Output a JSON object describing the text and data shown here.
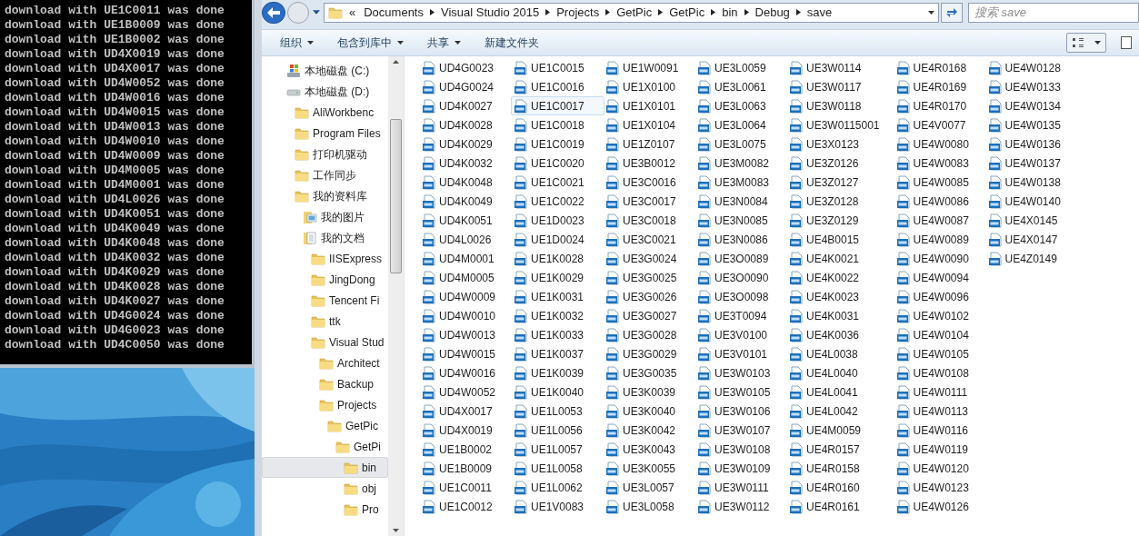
{
  "console": {
    "lines": [
      "download with UE1C0011 was done",
      "download with UE1B0009 was done",
      "download with UE1B0002 was done",
      "download with UD4X0019 was done",
      "download with UD4X0017 was done",
      "download with UD4W0052 was done",
      "download with UD4W0016 was done",
      "download with UD4W0015 was done",
      "download with UD4W0013 was done",
      "download with UD4W0010 was done",
      "download with UD4W0009 was done",
      "download with UD4M0005 was done",
      "download with UD4M0001 was done",
      "download with UD4L0026 was done",
      "download with UD4K0051 was done",
      "download with UD4K0049 was done",
      "download with UD4K0048 was done",
      "download with UD4K0032 was done",
      "download with UD4K0029 was done",
      "download with UD4K0028 was done",
      "download with UD4K0027 was done",
      "download with UD4G0024 was done",
      "download with UD4G0023 was done",
      "download with UD4C0050 was done"
    ]
  },
  "explorer": {
    "address": {
      "overflow": "«",
      "path": [
        "Documents",
        "Visual Studio 2015",
        "Projects",
        "GetPic",
        "GetPic",
        "bin",
        "Debug",
        "save"
      ]
    },
    "search": {
      "placeholder": "搜索 save"
    },
    "toolbar": [
      {
        "label": "组织",
        "dropdown": true
      },
      {
        "label": "包含到库中",
        "dropdown": true
      },
      {
        "label": "共享",
        "dropdown": true
      },
      {
        "label": "新建文件夹",
        "dropdown": false
      }
    ],
    "navigation": [
      {
        "label": "本地磁盘 (C:)",
        "kind": "system-drive",
        "selected": false
      },
      {
        "label": "本地磁盘 (D:)",
        "kind": "drive",
        "selected": false,
        "children": [
          {
            "label": "AliWorkbenc",
            "kind": "folder",
            "selected": false
          },
          {
            "label": "Program Files",
            "kind": "folder",
            "selected": false
          },
          {
            "label": "打印机驱动",
            "kind": "folder",
            "selected": false
          },
          {
            "label": "工作同步",
            "kind": "folder",
            "selected": false
          },
          {
            "label": "我的资料库",
            "kind": "folder",
            "selected": false,
            "children": [
              {
                "label": "我的图片",
                "kind": "pictures",
                "selected": false
              },
              {
                "label": "我的文档",
                "kind": "documents",
                "selected": false,
                "children": [
                  {
                    "label": "IISExpress",
                    "kind": "folder",
                    "selected": false
                  },
                  {
                    "label": "JingDong",
                    "kind": "folder",
                    "selected": false
                  },
                  {
                    "label": "Tencent Fi",
                    "kind": "folder",
                    "selected": false
                  },
                  {
                    "label": "ttk",
                    "kind": "folder",
                    "selected": false
                  },
                  {
                    "label": "Visual Stud",
                    "kind": "folder",
                    "selected": false,
                    "children": [
                      {
                        "label": "Architect",
                        "kind": "folder",
                        "selected": false
                      },
                      {
                        "label": "Backup",
                        "kind": "folder",
                        "selected": false
                      },
                      {
                        "label": "Projects",
                        "kind": "folder",
                        "selected": false,
                        "children": [
                          {
                            "label": "GetPic",
                            "kind": "folder",
                            "selected": false,
                            "children": [
                              {
                                "label": "GetPi",
                                "kind": "folder",
                                "selected": false,
                                "children": [
                                  {
                                    "label": "bin",
                                    "kind": "folder",
                                    "selected": true
                                  },
                                  {
                                    "label": "obj",
                                    "kind": "folder",
                                    "selected": false
                                  },
                                  {
                                    "label": "Pro",
                                    "kind": "folder",
                                    "selected": false
                                  }
                                ]
                              }
                            ]
                          }
                        ]
                      }
                    ]
                  }
                ]
              }
            ]
          }
        ]
      }
    ],
    "files": [
      {
        "name": "UD4G0023",
        "selected": false
      },
      {
        "name": "UD4G0024",
        "selected": false
      },
      {
        "name": "UD4K0027",
        "selected": false
      },
      {
        "name": "UD4K0028",
        "selected": false
      },
      {
        "name": "UD4K0029",
        "selected": false
      },
      {
        "name": "UD4K0032",
        "selected": false
      },
      {
        "name": "UD4K0048",
        "selected": false
      },
      {
        "name": "UD4K0049",
        "selected": false
      },
      {
        "name": "UD4K0051",
        "selected": false
      },
      {
        "name": "UD4L0026",
        "selected": false
      },
      {
        "name": "UD4M0001",
        "selected": false
      },
      {
        "name": "UD4M0005",
        "selected": false
      },
      {
        "name": "UD4W0009",
        "selected": false
      },
      {
        "name": "UD4W0010",
        "selected": false
      },
      {
        "name": "UD4W0013",
        "selected": false
      },
      {
        "name": "UD4W0015",
        "selected": false
      },
      {
        "name": "UD4W0016",
        "selected": false
      },
      {
        "name": "UD4W0052",
        "selected": false
      },
      {
        "name": "UD4X0017",
        "selected": false
      },
      {
        "name": "UD4X0019",
        "selected": false
      },
      {
        "name": "UE1B0002",
        "selected": false
      },
      {
        "name": "UE1B0009",
        "selected": false
      },
      {
        "name": "UE1C0011",
        "selected": false
      },
      {
        "name": "UE1C0012",
        "selected": false
      },
      {
        "name": "UE1C0015",
        "selected": false
      },
      {
        "name": "UE1C0016",
        "selected": false
      },
      {
        "name": "UE1C0017",
        "selected": true
      },
      {
        "name": "UE1C0018",
        "selected": false
      },
      {
        "name": "UE1C0019",
        "selected": false
      },
      {
        "name": "UE1C0020",
        "selected": false
      },
      {
        "name": "UE1C0021",
        "selected": false
      },
      {
        "name": "UE1C0022",
        "selected": false
      },
      {
        "name": "UE1D0023",
        "selected": false
      },
      {
        "name": "UE1D0024",
        "selected": false
      },
      {
        "name": "UE1K0028",
        "selected": false
      },
      {
        "name": "UE1K0029",
        "selected": false
      },
      {
        "name": "UE1K0031",
        "selected": false
      },
      {
        "name": "UE1K0032",
        "selected": false
      },
      {
        "name": "UE1K0033",
        "selected": false
      },
      {
        "name": "UE1K0037",
        "selected": false
      },
      {
        "name": "UE1K0039",
        "selected": false
      },
      {
        "name": "UE1K0040",
        "selected": false
      },
      {
        "name": "UE1L0053",
        "selected": false
      },
      {
        "name": "UE1L0056",
        "selected": false
      },
      {
        "name": "UE1L0057",
        "selected": false
      },
      {
        "name": "UE1L0058",
        "selected": false
      },
      {
        "name": "UE1L0062",
        "selected": false
      },
      {
        "name": "UE1V0083",
        "selected": false
      },
      {
        "name": "UE1W0091",
        "selected": false
      },
      {
        "name": "UE1X0100",
        "selected": false
      },
      {
        "name": "UE1X0101",
        "selected": false
      },
      {
        "name": "UE1X0104",
        "selected": false
      },
      {
        "name": "UE1Z0107",
        "selected": false
      },
      {
        "name": "UE3B0012",
        "selected": false
      },
      {
        "name": "UE3C0016",
        "selected": false
      },
      {
        "name": "UE3C0017",
        "selected": false
      },
      {
        "name": "UE3C0018",
        "selected": false
      },
      {
        "name": "UE3C0021",
        "selected": false
      },
      {
        "name": "UE3G0024",
        "selected": false
      },
      {
        "name": "UE3G0025",
        "selected": false
      },
      {
        "name": "UE3G0026",
        "selected": false
      },
      {
        "name": "UE3G0027",
        "selected": false
      },
      {
        "name": "UE3G0028",
        "selected": false
      },
      {
        "name": "UE3G0029",
        "selected": false
      },
      {
        "name": "UE3G0035",
        "selected": false
      },
      {
        "name": "UE3K0039",
        "selected": false
      },
      {
        "name": "UE3K0040",
        "selected": false
      },
      {
        "name": "UE3K0042",
        "selected": false
      },
      {
        "name": "UE3K0043",
        "selected": false
      },
      {
        "name": "UE3K0055",
        "selected": false
      },
      {
        "name": "UE3L0057",
        "selected": false
      },
      {
        "name": "UE3L0058",
        "selected": false
      },
      {
        "name": "UE3L0059",
        "selected": false
      },
      {
        "name": "UE3L0061",
        "selected": false
      },
      {
        "name": "UE3L0063",
        "selected": false
      },
      {
        "name": "UE3L0064",
        "selected": false
      },
      {
        "name": "UE3L0075",
        "selected": false
      },
      {
        "name": "UE3M0082",
        "selected": false
      },
      {
        "name": "UE3M0083",
        "selected": false
      },
      {
        "name": "UE3N0084",
        "selected": false
      },
      {
        "name": "UE3N0085",
        "selected": false
      },
      {
        "name": "UE3N0086",
        "selected": false
      },
      {
        "name": "UE3O0089",
        "selected": false
      },
      {
        "name": "UE3O0090",
        "selected": false
      },
      {
        "name": "UE3O0098",
        "selected": false
      },
      {
        "name": "UE3T0094",
        "selected": false
      },
      {
        "name": "UE3V0100",
        "selected": false
      },
      {
        "name": "UE3V0101",
        "selected": false
      },
      {
        "name": "UE3W0103",
        "selected": false
      },
      {
        "name": "UE3W0105",
        "selected": false
      },
      {
        "name": "UE3W0106",
        "selected": false
      },
      {
        "name": "UE3W0107",
        "selected": false
      },
      {
        "name": "UE3W0108",
        "selected": false
      },
      {
        "name": "UE3W0109",
        "selected": false
      },
      {
        "name": "UE3W0111",
        "selected": false
      },
      {
        "name": "UE3W0112",
        "selected": false
      },
      {
        "name": "UE3W0114",
        "selected": false
      },
      {
        "name": "UE3W0117",
        "selected": false
      },
      {
        "name": "UE3W0118",
        "selected": false
      },
      {
        "name": "UE3W0115001",
        "selected": false
      },
      {
        "name": "UE3X0123",
        "selected": false
      },
      {
        "name": "UE3Z0126",
        "selected": false
      },
      {
        "name": "UE3Z0127",
        "selected": false
      },
      {
        "name": "UE3Z0128",
        "selected": false
      },
      {
        "name": "UE3Z0129",
        "selected": false
      },
      {
        "name": "UE4B0015",
        "selected": false
      },
      {
        "name": "UE4K0021",
        "selected": false
      },
      {
        "name": "UE4K0022",
        "selected": false
      },
      {
        "name": "UE4K0023",
        "selected": false
      },
      {
        "name": "UE4K0031",
        "selected": false
      },
      {
        "name": "UE4K0036",
        "selected": false
      },
      {
        "name": "UE4L0038",
        "selected": false
      },
      {
        "name": "UE4L0040",
        "selected": false
      },
      {
        "name": "UE4L0041",
        "selected": false
      },
      {
        "name": "UE4L0042",
        "selected": false
      },
      {
        "name": "UE4M0059",
        "selected": false
      },
      {
        "name": "UE4R0157",
        "selected": false
      },
      {
        "name": "UE4R0158",
        "selected": false
      },
      {
        "name": "UE4R0160",
        "selected": false
      },
      {
        "name": "UE4R0161",
        "selected": false
      },
      {
        "name": "UE4R0168",
        "selected": false
      },
      {
        "name": "UE4R0169",
        "selected": false
      },
      {
        "name": "UE4R0170",
        "selected": false
      },
      {
        "name": "UE4V0077",
        "selected": false
      },
      {
        "name": "UE4W0080",
        "selected": false
      },
      {
        "name": "UE4W0083",
        "selected": false
      },
      {
        "name": "UE4W0085",
        "selected": false
      },
      {
        "name": "UE4W0086",
        "selected": false
      },
      {
        "name": "UE4W0087",
        "selected": false
      },
      {
        "name": "UE4W0089",
        "selected": false
      },
      {
        "name": "UE4W0090",
        "selected": false
      },
      {
        "name": "UE4W0094",
        "selected": false
      },
      {
        "name": "UE4W0096",
        "selected": false
      },
      {
        "name": "UE4W0102",
        "selected": false
      },
      {
        "name": "UE4W0104",
        "selected": false
      },
      {
        "name": "UE4W0105",
        "selected": false
      },
      {
        "name": "UE4W0108",
        "selected": false
      },
      {
        "name": "UE4W0111",
        "selected": false
      },
      {
        "name": "UE4W0113",
        "selected": false
      },
      {
        "name": "UE4W0116",
        "selected": false
      },
      {
        "name": "UE4W0119",
        "selected": false
      },
      {
        "name": "UE4W0120",
        "selected": false
      },
      {
        "name": "UE4W0123",
        "selected": false
      },
      {
        "name": "UE4W0126",
        "selected": false
      },
      {
        "name": "UE4W0128",
        "selected": false
      },
      {
        "name": "UE4W0133",
        "selected": false
      },
      {
        "name": "UE4W0134",
        "selected": false
      },
      {
        "name": "UE4W0135",
        "selected": false
      },
      {
        "name": "UE4W0136",
        "selected": false
      },
      {
        "name": "UE4W0137",
        "selected": false
      },
      {
        "name": "UE4W0138",
        "selected": false
      },
      {
        "name": "UE4W0140",
        "selected": false
      },
      {
        "name": "UE4X0145",
        "selected": false
      },
      {
        "name": "UE4X0147",
        "selected": false
      },
      {
        "name": "UE4Z0149",
        "selected": false
      }
    ]
  }
}
